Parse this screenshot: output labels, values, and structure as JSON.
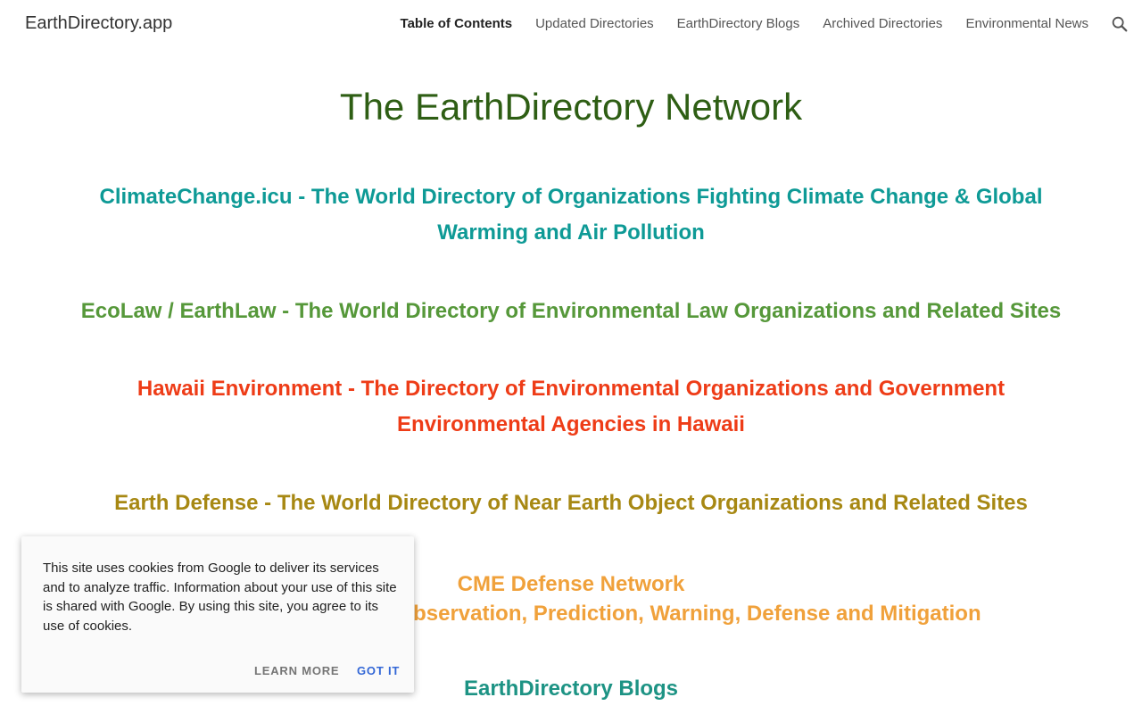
{
  "header": {
    "site_title": "EarthDirectory.app",
    "nav": [
      {
        "label": "Table of Contents",
        "active": true
      },
      {
        "label": "Updated Directories",
        "active": false
      },
      {
        "label": "EarthDirectory Blogs",
        "active": false
      },
      {
        "label": "Archived Directories",
        "active": false
      },
      {
        "label": "Environmental News",
        "active": false
      }
    ],
    "search_icon": "search-icon"
  },
  "main": {
    "title": "The EarthDirectory Network",
    "links": [
      {
        "text": "ClimateChange.icu - The World Directory of Organizations Fighting Climate Change & Global Warming and Air Pollution",
        "color": "#0e9a96"
      },
      {
        "text": "EcoLaw / EarthLaw - The World Directory of Environmental Law Organizations and Related Sites",
        "color": "#56983a"
      },
      {
        "text": "Hawaii Environment - The Directory of Environmental Organizations and Government Environmental Agencies in Hawaii",
        "color": "#ee3c17"
      },
      {
        "text": "Earth Defense - The World Directory of Near Earth Object Organizations and Related Sites",
        "color": "#a78813"
      },
      {
        "text": "CME Defense Network",
        "subtitle": "Coronal Mass Ejection Observation, Prediction, Warning, Defense and Mitigation",
        "color": "#f0a13b"
      },
      {
        "text": "EarthDirectory Blogs",
        "color": "#1d9384"
      }
    ]
  },
  "cookie_banner": {
    "message": "This site uses cookies from Google to deliver its services and to analyze traffic. Information about your use of this site is shared with Google. By using this site, you agree to its use of cookies.",
    "learn_more": "LEARN MORE",
    "got_it": "GOT IT"
  }
}
